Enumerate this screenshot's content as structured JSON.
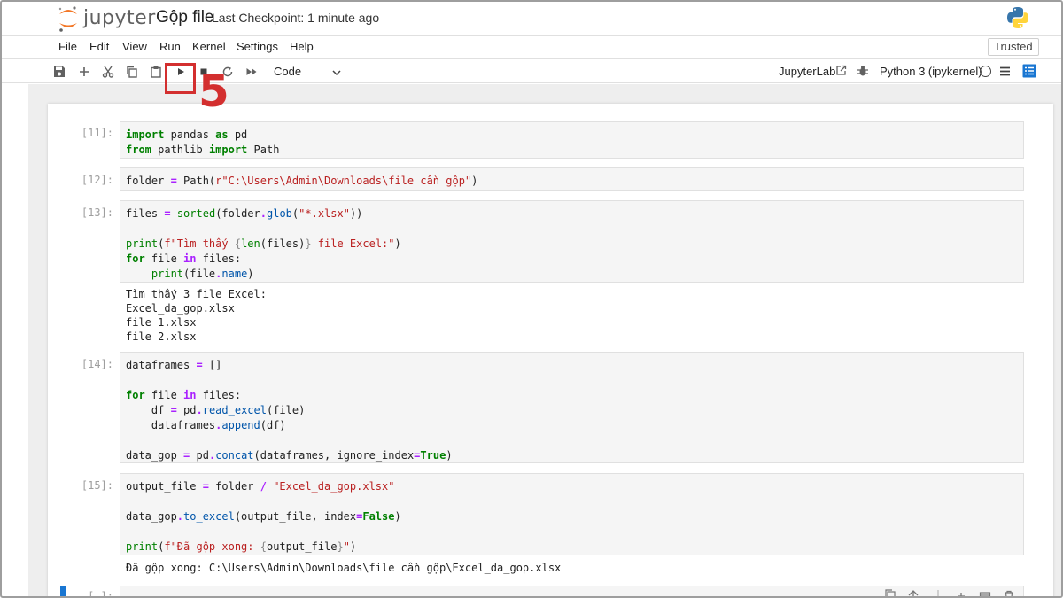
{
  "app": {
    "logo_text": "jupyter",
    "notebook_title": "Gộp file",
    "checkpoint": "Last Checkpoint: 1 minute ago"
  },
  "menu": [
    "File",
    "Edit",
    "View",
    "Run",
    "Kernel",
    "Settings",
    "Help"
  ],
  "trusted_label": "Trusted",
  "toolbar": {
    "buttons": [
      "save-icon",
      "plus-icon",
      "scissors-icon",
      "copy-icon",
      "paste-icon",
      "run-icon",
      "stop-icon",
      "restart-icon",
      "fast-forward-icon"
    ],
    "cell_type": "Code",
    "jupyterlab_label": "JupyterLab",
    "kernel_name": "Python 3 (ipykernel)"
  },
  "annotation": {
    "step_number": "5"
  },
  "cells": [
    {
      "prompt": "[11]:",
      "lines": [
        "import pandas as pd",
        "from pathlib import Path"
      ]
    },
    {
      "prompt": "[12]:",
      "lines": [
        "folder = Path(r\"C:\\Users\\Admin\\Downloads\\file cần gộp\")"
      ]
    },
    {
      "prompt": "[13]:",
      "lines": [
        "files = sorted(folder.glob(\"*.xlsx\"))",
        "",
        "print(f\"Tìm thấy {len(files)} file Excel:\")",
        "for file in files:",
        "    print(file.name)"
      ],
      "output": [
        "Tìm thấy 3 file Excel:",
        "Excel_da_gop.xlsx",
        "file 1.xlsx",
        "file 2.xlsx"
      ]
    },
    {
      "prompt": "[14]:",
      "lines": [
        "dataframes = []",
        "",
        "for file in files:",
        "    df = pd.read_excel(file)",
        "    dataframes.append(df)",
        "",
        "data_gop = pd.concat(dataframes, ignore_index=True)"
      ]
    },
    {
      "prompt": "[15]:",
      "lines": [
        "output_file = folder / \"Excel_da_gop.xlsx\"",
        "",
        "data_gop.to_excel(output_file, index=False)",
        "",
        "print(f\"Đã gộp xong: {output_file}\")"
      ],
      "output": [
        "Đã gộp xong: C:\\Users\\Admin\\Downloads\\file cần gộp\\Excel_da_gop.xlsx"
      ]
    },
    {
      "prompt": "[ ]:",
      "lines": []
    }
  ],
  "colors": {
    "accent": "#1976d2",
    "annotation": "#d32f2f",
    "keyword": "#008000",
    "string": "#ba2121"
  }
}
